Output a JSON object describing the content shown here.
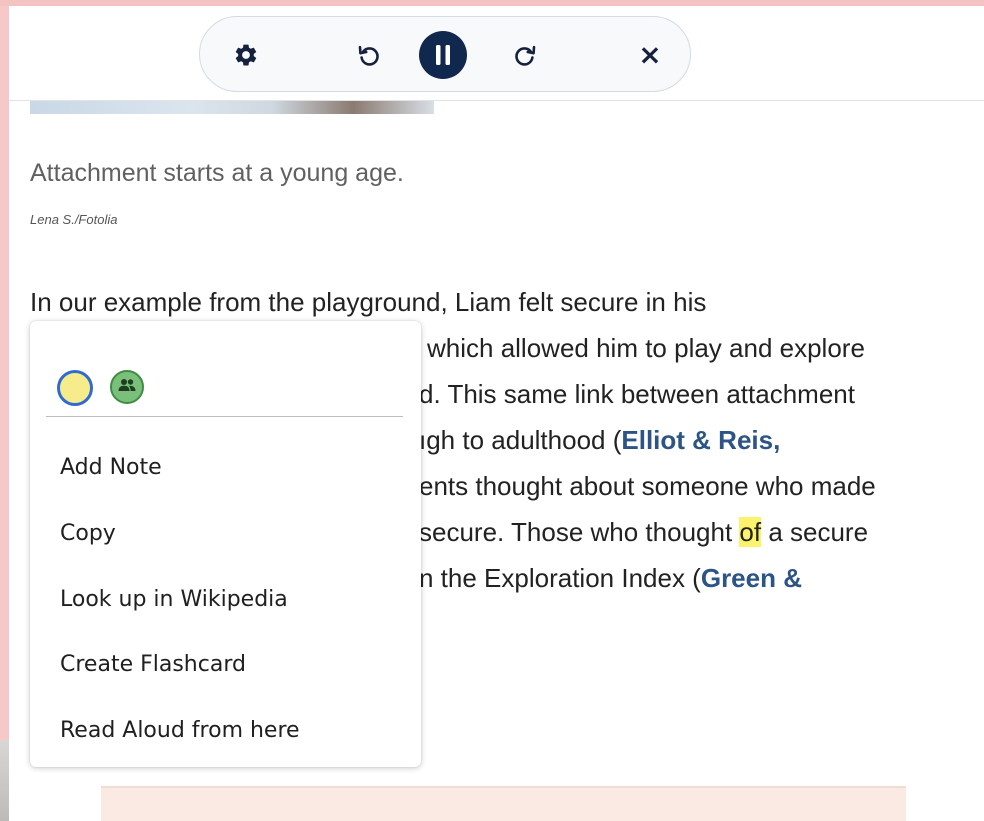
{
  "toolbar": {
    "buttons": [
      {
        "name": "settings",
        "icon": "gear-icon"
      },
      {
        "name": "rewind",
        "icon": "rotate-ccw-icon"
      },
      {
        "name": "pause",
        "icon": "pause-icon"
      },
      {
        "name": "forward",
        "icon": "rotate-cw-icon"
      },
      {
        "name": "close",
        "icon": "close-icon"
      }
    ],
    "close_glyph": "×"
  },
  "figure": {
    "caption": "Attachment starts at a young age.",
    "credit": "Lena S./Fotolia"
  },
  "paragraph": {
    "line1": "In our example from the playground, Liam felt secure in his",
    "line2": "which allowed him to play and explore",
    "line3": "d. This same link between attachment",
    "line4_text": "ıgh to adulthood (",
    "line4_link": "Elliot & Reis,",
    "line5": "ents thought about someone who made",
    "line6_before": "secure. Those who thought ",
    "line6_highlight": "of",
    "line6_after": " a secure",
    "line7_text": "n the Exploration Index (",
    "line7_link": "Green &"
  },
  "context_menu": {
    "highlight_colors": [
      {
        "name": "yellow",
        "color": "#f6ec8c",
        "selected": true
      },
      {
        "name": "green-shared",
        "color": "#7ac07a",
        "icon": "group-icon"
      }
    ],
    "items": [
      "Add Note",
      "Copy",
      "Look up in Wikipedia",
      "Create Flashcard",
      "Read Aloud from here"
    ]
  },
  "colors": {
    "accent_dark": "#10284d",
    "link": "#2c5485",
    "highlight": "#fbf36b",
    "frame_pink": "#f4c9c7"
  }
}
